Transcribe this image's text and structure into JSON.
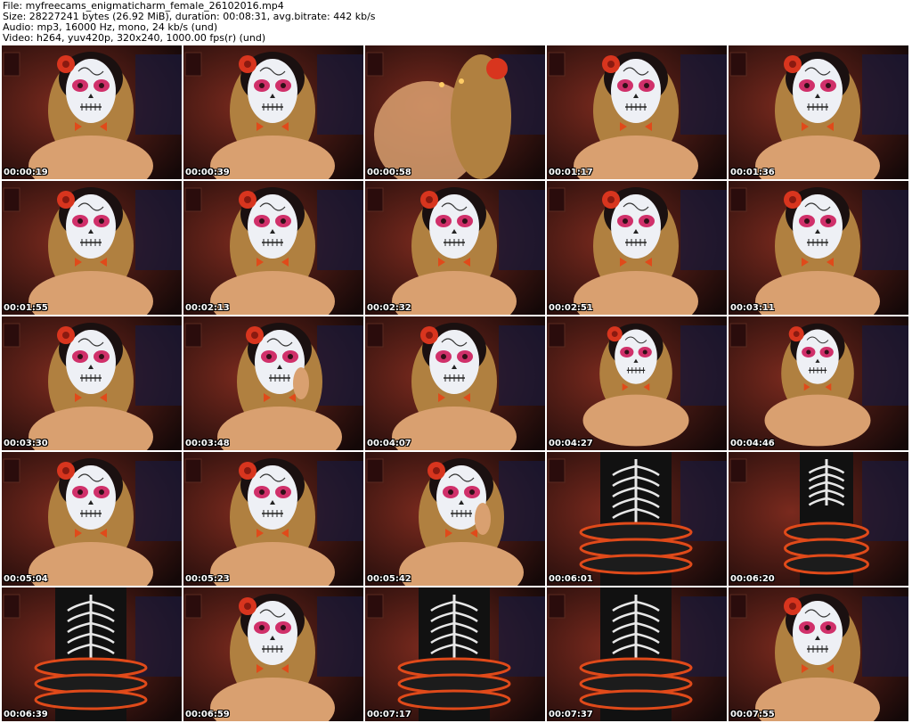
{
  "header": {
    "file_line": "File: myfreecams_enigmaticharm_female_26102016.mp4",
    "size_line": "Size: 28227241 bytes (26.92 MiB), duration: 00:08:31, avg.bitrate: 442 kb/s",
    "audio_line": "Audio: mp3, 16000 Hz, mono, 24 kb/s (und)",
    "video_line": "Video: h264, yuv420p, 320x240, 1000.00 fps(r) (und)"
  },
  "thumbnails": [
    {
      "time": "00:00:19",
      "scene": "face"
    },
    {
      "time": "00:00:39",
      "scene": "face"
    },
    {
      "time": "00:00:58",
      "scene": "back"
    },
    {
      "time": "00:01:17",
      "scene": "face"
    },
    {
      "time": "00:01:36",
      "scene": "face"
    },
    {
      "time": "00:01:55",
      "scene": "face"
    },
    {
      "time": "00:02:13",
      "scene": "face"
    },
    {
      "time": "00:02:32",
      "scene": "face"
    },
    {
      "time": "00:02:51",
      "scene": "face"
    },
    {
      "time": "00:03:11",
      "scene": "face"
    },
    {
      "time": "00:03:30",
      "scene": "face"
    },
    {
      "time": "00:03:48",
      "scene": "face-hand"
    },
    {
      "time": "00:04:07",
      "scene": "face"
    },
    {
      "time": "00:04:27",
      "scene": "face-wide"
    },
    {
      "time": "00:04:46",
      "scene": "face-wide"
    },
    {
      "time": "00:05:04",
      "scene": "face"
    },
    {
      "time": "00:05:23",
      "scene": "face"
    },
    {
      "time": "00:05:42",
      "scene": "face-hand"
    },
    {
      "time": "00:06:01",
      "scene": "costume"
    },
    {
      "time": "00:06:20",
      "scene": "costume-far"
    },
    {
      "time": "00:06:39",
      "scene": "costume"
    },
    {
      "time": "00:06:59",
      "scene": "face"
    },
    {
      "time": "00:07:17",
      "scene": "costume"
    },
    {
      "time": "00:07:37",
      "scene": "costume"
    },
    {
      "time": "00:07:55",
      "scene": "face"
    }
  ],
  "colors": {
    "wall": "#7a2a1e",
    "shadow": "#140808",
    "skin": "#d9a070",
    "face_paint": "#eef0f5",
    "eye_paint": "#d0306a",
    "rose": "#d8351e",
    "hair": "#b08040",
    "dress": "#111111",
    "ruffle": "#e04a1a",
    "bone": "#e8e8e8"
  }
}
